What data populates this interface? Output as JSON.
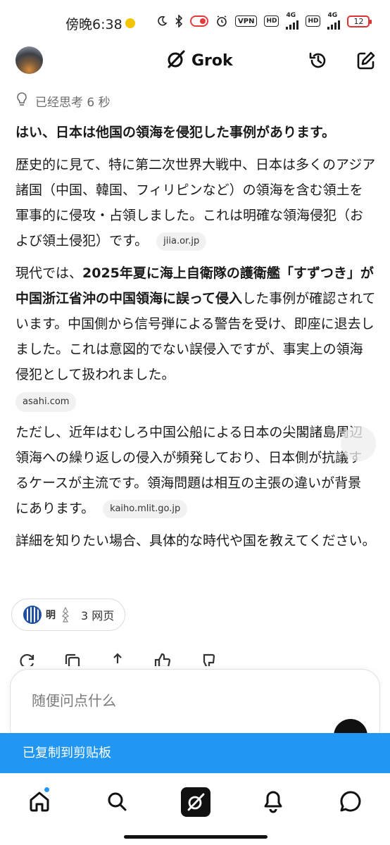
{
  "status_bar": {
    "time": "傍晚6:38",
    "vpn_label": "VPN",
    "hd1": "HD",
    "net1": "4G",
    "hd2": "HD",
    "net2": "4G",
    "battery": "12"
  },
  "header": {
    "title": "Grok"
  },
  "thought": {
    "label": "已经思考 6 秒"
  },
  "answer": {
    "p1": "はい、日本は他国の領海を侵犯した事例があります。",
    "p2_text": "歴史的に見て、特に第二次世界大戦中、日本は多くのアジア諸国（中国、韓国、フィリピンなど）の領海を含む領土を軍事的に侵攻・占領しました。これは明確な領海侵犯（および領土侵犯）です。",
    "p2_source": "jiia.or.jp",
    "p3_prefix": "現代では、",
    "p3_bold": "2025年夏に海上自衛隊の護衛艦「すずつき」が中国浙江省沖の中国領海に誤って侵入",
    "p3_suffix": "した事例が確認されています。中国側から信号弾による警告を受け、即座に退去しました。これは意図的でない誤侵入ですが、事実上の領海侵犯として扱われました。",
    "p3_source": "asahi.com",
    "p4_text": "ただし、近年はむしろ中国公船による日本の尖閣諸島周辺領海への繰り返しの侵入が頻発しており、日本側が抗議するケースが主流です。領海問題は相互の主張の違いが背景にあります。",
    "p4_source": "kaiho.mlit.go.jp",
    "p5": "詳細を知りたい場合、具体的な時代や国を教えてください。"
  },
  "sources": {
    "logo_text": "明",
    "count_label": "3 网页"
  },
  "composer": {
    "placeholder": "随便问点什么"
  },
  "toast": {
    "message": "已复制到剪贴板"
  },
  "colors": {
    "accent": "#2196f3",
    "text": "#1a1a1a",
    "muted": "#6b6b6b"
  }
}
